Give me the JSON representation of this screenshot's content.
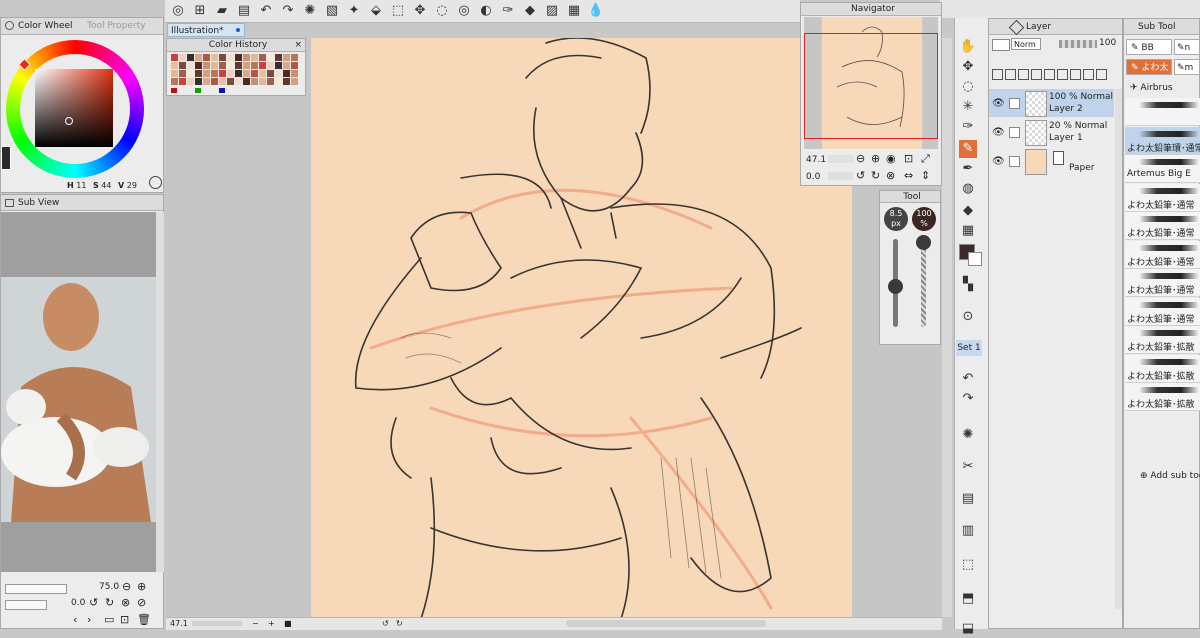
{
  "colors": {
    "canvas_bg": "#c6c6c6",
    "paper": "#f7d8b8",
    "accent": "#e07038",
    "selected": "#bfd4ea",
    "brand_blue": "#2255cc"
  },
  "top_toolbar": {
    "icons": [
      "app-menu-icon",
      "new-file-icon",
      "open-file-icon",
      "save-icon",
      "undo-icon",
      "redo-icon",
      "loading-icon",
      "clear-icon",
      "fill-icon",
      "eraser-icon",
      "transform-icon",
      "move-icon",
      "lasso-icon",
      "select-icon",
      "mask-icon",
      "eyedropper-icon",
      "color-icon",
      "ruler-icon",
      "grid-icon",
      "water-icon"
    ]
  },
  "color_wheel": {
    "tab_label": "Color Wheel",
    "tab2_label": "Tool Property",
    "h_label": "H",
    "h_value": "11",
    "s_label": "S",
    "s_value": "44",
    "v_label": "V",
    "v_value": "29"
  },
  "sub_view": {
    "tab_label": "Sub View",
    "zoom": "75.0",
    "rotation": "0.0"
  },
  "illustration_tab": {
    "label": "Illustration*"
  },
  "color_history": {
    "title": "Color History"
  },
  "navigator": {
    "title": "Navigator",
    "zoom": "47.1",
    "rotation": "0.0"
  },
  "tool_panel": {
    "title": "Tool",
    "size_value": "8.5",
    "size_unit": "px",
    "opacity_value": "100",
    "opacity_unit": "%"
  },
  "left_toolstrip": {
    "set_label": "Set 1"
  },
  "layer_panel": {
    "tab_label": "Layer",
    "blend_mode": "Norm",
    "opacity": "100",
    "layers": [
      {
        "line1": "100 % Normal",
        "line2": "Layer 2"
      },
      {
        "line1": "20 % Normal",
        "line2": "Layer 1"
      },
      {
        "line1": "",
        "line2": "Paper"
      }
    ]
  },
  "sub_tool": {
    "tab_label": "Sub Tool",
    "tabs": [
      "BB",
      "n",
      "よわ太",
      "m",
      "Airbrus"
    ],
    "brushes": [
      "",
      "よわ太鉛筆環･通常",
      "Artemus Big E",
      "よわ太鉛筆･通常",
      "よわ太鉛筆･通常",
      "よわ太鉛筆･通常",
      "よわ太鉛筆･通常",
      "よわ太鉛筆･通常",
      "よわ太鉛筆･拡散",
      "よわ太鉛筆･拡散",
      "よわ太鉛筆･拡散"
    ],
    "add_label": "Add sub too"
  },
  "status": {
    "zoom": "47.1"
  }
}
